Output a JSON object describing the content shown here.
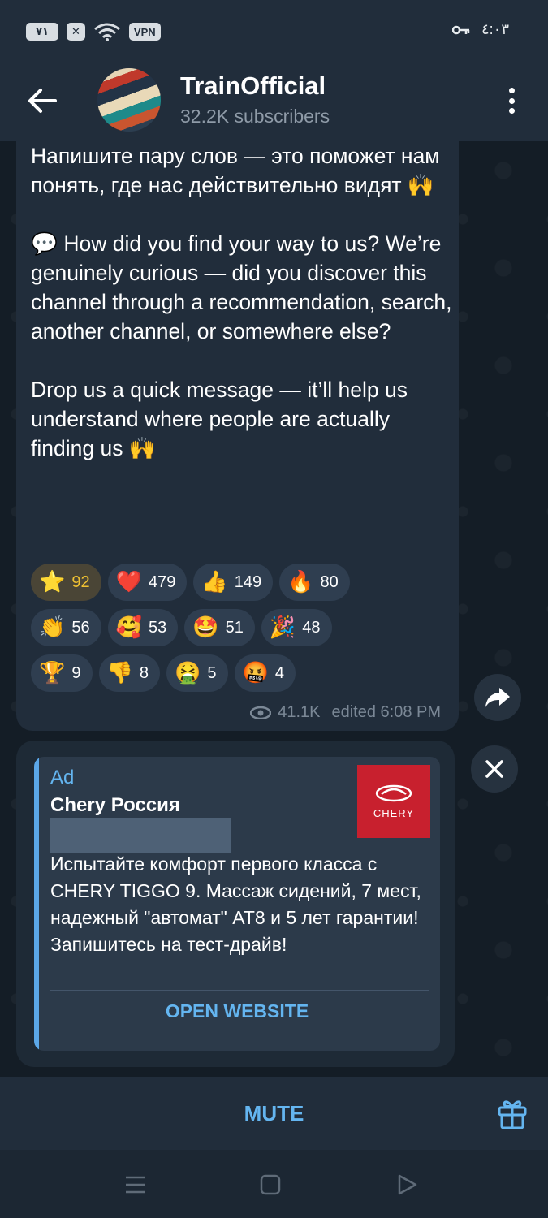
{
  "status_bar": {
    "battery_label": "٧١",
    "vpn_label": "VPN",
    "time": "٤:٠٣",
    "icons": [
      "battery-icon",
      "x-box-icon",
      "wifi-icon",
      "vpn-icon",
      "key-icon"
    ]
  },
  "header": {
    "title": "TrainOfficial",
    "subtitle": "32.2K subscribers",
    "icons": [
      "back-arrow-icon",
      "more-vertical-icon"
    ]
  },
  "message": {
    "text": "Напишите пару слов — это поможет нам понять, где нас действительно видят 🙌\n\n💬 How did you find your way to us? We’re genuinely curious — did you discover this channel through a recommendation, search, another channel, or somewhere else?\n\nDrop us a quick message — it’ll help us understand where people are actually finding us 🙌",
    "reactions": [
      [
        {
          "emoji": "⭐",
          "count": "92",
          "selected": true
        },
        {
          "emoji": "❤️",
          "count": "479",
          "selected": false
        },
        {
          "emoji": "👍",
          "count": "149",
          "selected": false
        },
        {
          "emoji": "🔥",
          "count": "80",
          "selected": false
        }
      ],
      [
        {
          "emoji": "👏",
          "count": "56",
          "selected": false
        },
        {
          "emoji": "🥰",
          "count": "53",
          "selected": false
        },
        {
          "emoji": "🤩",
          "count": "51",
          "selected": false
        },
        {
          "emoji": "🎉",
          "count": "48",
          "selected": false
        }
      ],
      [
        {
          "emoji": "🏆",
          "count": "9",
          "selected": false
        },
        {
          "emoji": "👎",
          "count": "8",
          "selected": false
        },
        {
          "emoji": "🤮",
          "count": "5",
          "selected": false
        },
        {
          "emoji": "🤬",
          "count": "4",
          "selected": false
        }
      ]
    ],
    "views": "41.1K",
    "edited": "edited 6:08 PM"
  },
  "ad": {
    "tag": "Ad",
    "advertiser": "Chery Россия",
    "logo_text": "CHERY",
    "body": "Испытайте комфорт первого класса с CHERY TIGGO 9. Массаж сидений, 7 мест, надежный \"автомат\" AT8 и 5 лет гарантии! Запишитесь на тест-драйв!",
    "cta": "OPEN WEBSITE"
  },
  "bottom_bar": {
    "mute_label": "MUTE"
  },
  "colors": {
    "accent": "#64b5f0",
    "header_bg": "#212d3b",
    "bubble_bg": "#212d3b",
    "selected_reaction": "#f1c232"
  }
}
